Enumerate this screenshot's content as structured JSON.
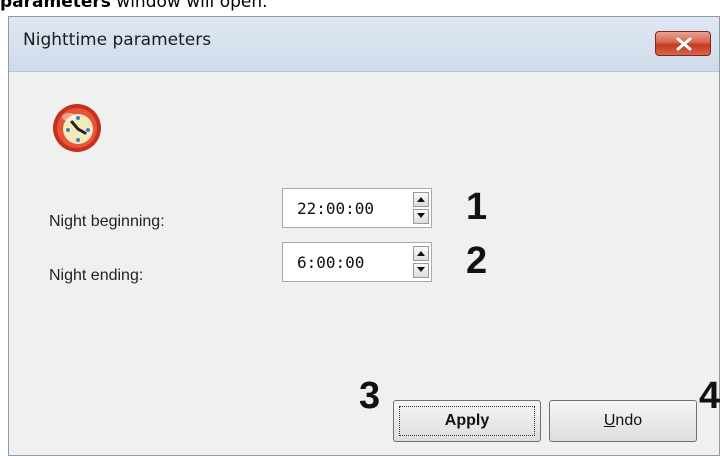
{
  "caption": {
    "bold_text": "parameters",
    "rest_text": " window will open."
  },
  "window": {
    "title": "Nighttime parameters",
    "close_icon": "close-x-icon",
    "app_icon": "clock-icon"
  },
  "fields": [
    {
      "label": "Night beginning:",
      "value": "22:00:00",
      "marker": "1"
    },
    {
      "label": "Night ending:",
      "value": "6:00:00",
      "marker": "2"
    }
  ],
  "buttons": {
    "apply": {
      "label": "Apply",
      "marker": "3"
    },
    "undo": {
      "label_underlined": "U",
      "label_rest": "ndo",
      "marker": "4"
    }
  },
  "colors": {
    "close_button": "#d9644b",
    "clock_red": "#c8301e",
    "clock_face": "#f4e9b8"
  }
}
